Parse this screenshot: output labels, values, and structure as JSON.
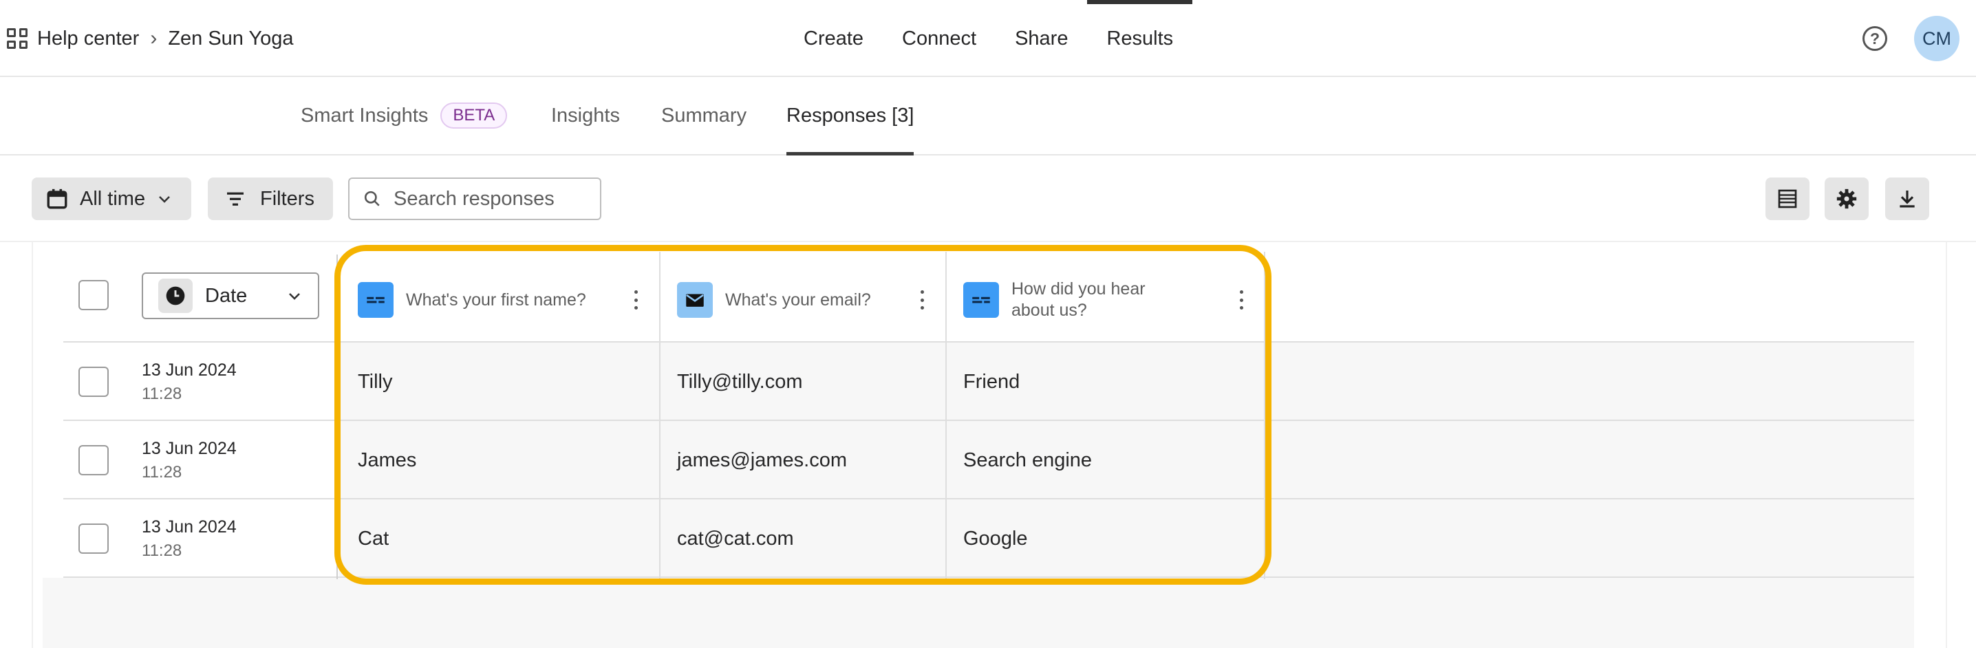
{
  "breadcrumb": {
    "root": "Help center",
    "current": "Zen Sun Yoga"
  },
  "main_tabs": [
    "Create",
    "Connect",
    "Share",
    "Results"
  ],
  "active_main_tab": "Results",
  "avatar_initials": "CM",
  "sub_tabs": {
    "smart_insights": "Smart Insights",
    "beta": "BETA",
    "insights": "Insights",
    "summary": "Summary",
    "responses": "Responses [3]"
  },
  "toolbar": {
    "time_filter": "All time",
    "filters": "Filters",
    "search_placeholder": "Search responses"
  },
  "table": {
    "sort_select": "Date",
    "columns": [
      {
        "label": "What's your first name?",
        "icon": "short-text-icon"
      },
      {
        "label": "What's your email?",
        "icon": "email-icon"
      },
      {
        "label": "How did you hear about us?",
        "icon": "short-text-icon"
      }
    ],
    "rows": [
      {
        "date": "13 Jun 2024",
        "time": "11:28",
        "name": "Tilly",
        "email": "Tilly@tilly.com",
        "source": "Friend"
      },
      {
        "date": "13 Jun 2024",
        "time": "11:28",
        "name": "James",
        "email": "james@james.com",
        "source": "Search engine"
      },
      {
        "date": "13 Jun 2024",
        "time": "11:28",
        "name": "Cat",
        "email": "cat@cat.com",
        "source": "Google"
      }
    ]
  },
  "colors": {
    "highlight": "#f5b300",
    "question_icon_blue": "#3d9bf5",
    "email_icon_blue": "#8cc4f4",
    "beta_purple": "#7b2d8e"
  }
}
